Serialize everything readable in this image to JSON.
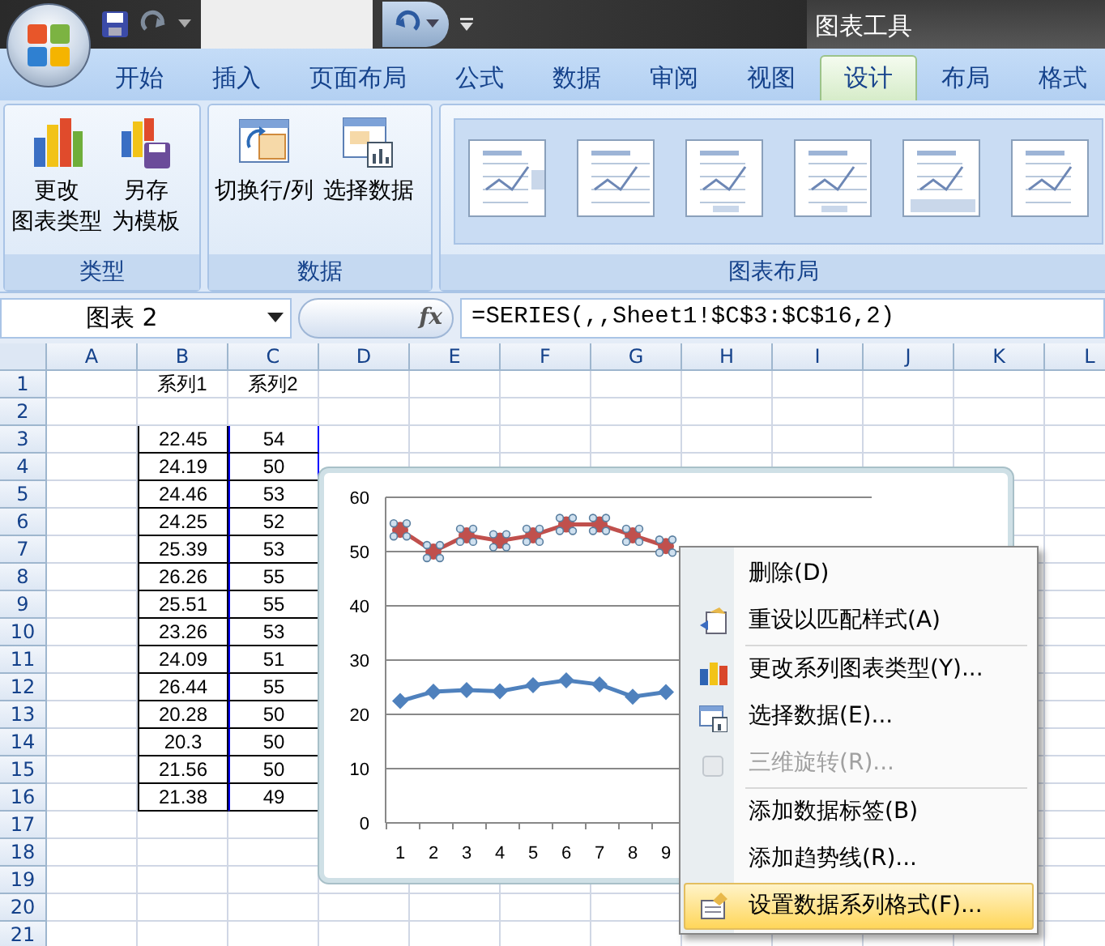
{
  "contextual_title": "图表工具",
  "tabs": [
    {
      "label": "开始",
      "selected": false
    },
    {
      "label": "插入",
      "selected": false
    },
    {
      "label": "页面布局",
      "selected": false
    },
    {
      "label": "公式",
      "selected": false
    },
    {
      "label": "数据",
      "selected": false
    },
    {
      "label": "审阅",
      "selected": false
    },
    {
      "label": "视图",
      "selected": false
    },
    {
      "label": "设计",
      "selected": true
    },
    {
      "label": "布局",
      "selected": false
    },
    {
      "label": "格式",
      "selected": false
    }
  ],
  "ribbon_groups": [
    {
      "label": "类型",
      "kind": "buttons",
      "buttons": [
        {
          "lines": [
            "更改",
            "图表类型"
          ]
        },
        {
          "lines": [
            "另存",
            "为模板"
          ]
        }
      ]
    },
    {
      "label": "数据",
      "kind": "buttons",
      "buttons": [
        {
          "lines": [
            "切换行/列"
          ]
        },
        {
          "lines": [
            "选择数据"
          ]
        }
      ]
    },
    {
      "label": "图表布局",
      "kind": "gallery"
    }
  ],
  "name_box": "图表 2",
  "function_button": "fx",
  "formula": "=SERIES(,,Sheet1!$C$3:$C$16,2)",
  "sheet": {
    "columns": [
      "A",
      "B",
      "C",
      "D",
      "E",
      "F",
      "G",
      "H",
      "I",
      "J",
      "K",
      "L"
    ],
    "rows": [
      {
        "number": "1",
        "cells": {
          "B": {
            "text": "系列1"
          },
          "C": {
            "text": "系列2"
          }
        }
      },
      {
        "number": "2"
      },
      {
        "number": "3",
        "framed": true,
        "cells": {
          "B": {
            "text": "22.45"
          },
          "C": {
            "text": "54",
            "selected": true
          }
        }
      },
      {
        "number": "4",
        "framed": true,
        "cells": {
          "B": {
            "text": "24.19"
          },
          "C": {
            "text": "50",
            "selected": true
          }
        }
      },
      {
        "number": "5",
        "framed": true,
        "cells": {
          "B": {
            "text": "24.46"
          },
          "C": {
            "text": "53",
            "selected": true
          }
        }
      },
      {
        "number": "6",
        "framed": true,
        "cells": {
          "B": {
            "text": "24.25"
          },
          "C": {
            "text": "52",
            "selected": true
          }
        }
      },
      {
        "number": "7",
        "framed": true,
        "cells": {
          "B": {
            "text": "25.39"
          },
          "C": {
            "text": "53",
            "selected": true
          }
        }
      },
      {
        "number": "8",
        "framed": true,
        "cells": {
          "B": {
            "text": "26.26"
          },
          "C": {
            "text": "55",
            "selected": true
          }
        }
      },
      {
        "number": "9",
        "framed": true,
        "cells": {
          "B": {
            "text": "25.51"
          },
          "C": {
            "text": "55",
            "selected": true
          }
        }
      },
      {
        "number": "10",
        "framed": true,
        "cells": {
          "B": {
            "text": "23.26"
          },
          "C": {
            "text": "53",
            "selected": true
          }
        }
      },
      {
        "number": "11",
        "framed": true,
        "cells": {
          "B": {
            "text": "24.09"
          },
          "C": {
            "text": "51",
            "selected": true
          }
        }
      },
      {
        "number": "12",
        "framed": true,
        "cells": {
          "B": {
            "text": "26.44"
          },
          "C": {
            "text": "55",
            "selected": true
          }
        }
      },
      {
        "number": "13",
        "framed": true,
        "cells": {
          "B": {
            "text": "20.28"
          },
          "C": {
            "text": "50",
            "selected": true
          }
        }
      },
      {
        "number": "14",
        "framed": true,
        "cells": {
          "B": {
            "text": "20.3"
          },
          "C": {
            "text": "50",
            "selected": true
          }
        }
      },
      {
        "number": "15",
        "framed": true,
        "cells": {
          "B": {
            "text": "21.56"
          },
          "C": {
            "text": "50",
            "selected": true
          }
        }
      },
      {
        "number": "16",
        "framed": true,
        "cells": {
          "B": {
            "text": "21.38"
          },
          "C": {
            "text": "49",
            "selected": true
          }
        }
      },
      {
        "number": "17"
      },
      {
        "number": "18"
      },
      {
        "number": "19"
      },
      {
        "number": "20"
      },
      {
        "number": "21"
      }
    ]
  },
  "chart": {
    "series_state": [
      {
        "selected": false
      },
      {
        "selected": true
      }
    ],
    "chart_data": {
      "type": "line",
      "grid": true,
      "categories": [
        "1",
        "2",
        "3",
        "4",
        "5",
        "6",
        "7",
        "8",
        "9"
      ],
      "ylim": [
        0,
        60
      ],
      "yticks": [
        {
          "value": 0,
          "label": "0"
        },
        {
          "value": 10,
          "label": "10"
        },
        {
          "value": 20,
          "label": "20"
        },
        {
          "value": 30,
          "label": "30"
        },
        {
          "value": 40,
          "label": "40"
        },
        {
          "value": 50,
          "label": "50"
        },
        {
          "value": 60,
          "label": "60"
        }
      ],
      "series": [
        {
          "color": "#4f81bd",
          "marker": "diamond",
          "values": [
            22.45,
            24.19,
            24.46,
            24.25,
            25.39,
            26.26,
            25.51,
            23.26,
            24.09
          ]
        },
        {
          "color": "#c0504d",
          "marker": "circle",
          "values": [
            54,
            50,
            53,
            52,
            53,
            55,
            55,
            53,
            51
          ]
        }
      ]
    }
  },
  "context_menu": [
    {
      "kind": "item",
      "label": "删除(D)",
      "disabled": false,
      "selected": false
    },
    {
      "kind": "item",
      "label": "重设以匹配样式(A)",
      "disabled": false,
      "selected": false
    },
    {
      "kind": "separator"
    },
    {
      "kind": "item",
      "label": "更改系列图表类型(Y)...",
      "disabled": false,
      "selected": false
    },
    {
      "kind": "item",
      "label": "选择数据(E)...",
      "disabled": false,
      "selected": false
    },
    {
      "kind": "item",
      "label": "三维旋转(R)...",
      "disabled": true,
      "selected": false
    },
    {
      "kind": "separator"
    },
    {
      "kind": "item",
      "label": "添加数据标签(B)",
      "disabled": false,
      "selected": false
    },
    {
      "kind": "item",
      "label": "添加趋势线(R)...",
      "disabled": false,
      "selected": false
    },
    {
      "kind": "item",
      "label": "设置数据系列格式(F)...",
      "disabled": false,
      "selected": true
    }
  ]
}
